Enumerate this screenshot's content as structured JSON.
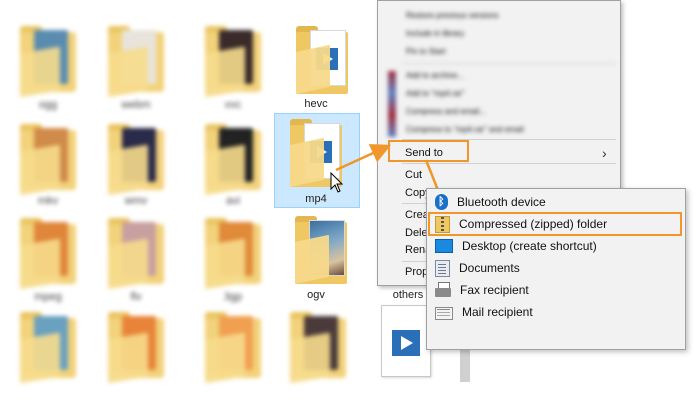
{
  "folders": {
    "hevc": "hevc",
    "mp4": "mp4",
    "ogv": "ogv",
    "others": "others"
  },
  "context_menu": {
    "blurred_top_items": [
      "Restore previous versions",
      "Include in library",
      "Pin to Start"
    ],
    "blurred_archive_items": [
      "Add to archive...",
      "Add to \"mp4.rar\"",
      "Compress and email...",
      "Compress to \"mp4.rar\" and email"
    ],
    "send_to": "Send to",
    "cut": "Cut",
    "copy": "Copy",
    "create_shortcut": "Crea",
    "delete": "Dele",
    "rename": "Rena",
    "properties": "Prop"
  },
  "send_to_submenu": {
    "items": [
      {
        "label": "Bluetooth device",
        "icon": "bluetooth-icon"
      },
      {
        "label": "Compressed (zipped) folder",
        "icon": "zip-folder-icon"
      },
      {
        "label": "Desktop (create shortcut)",
        "icon": "desktop-icon"
      },
      {
        "label": "Documents",
        "icon": "documents-icon"
      },
      {
        "label": "Fax recipient",
        "icon": "fax-icon"
      },
      {
        "label": "Mail recipient",
        "icon": "mail-icon"
      }
    ]
  },
  "colors": {
    "highlight": "#f0962a",
    "selection": "#cce8ff",
    "menu_bg": "#f2f2f2",
    "folder": "#f0c863"
  }
}
